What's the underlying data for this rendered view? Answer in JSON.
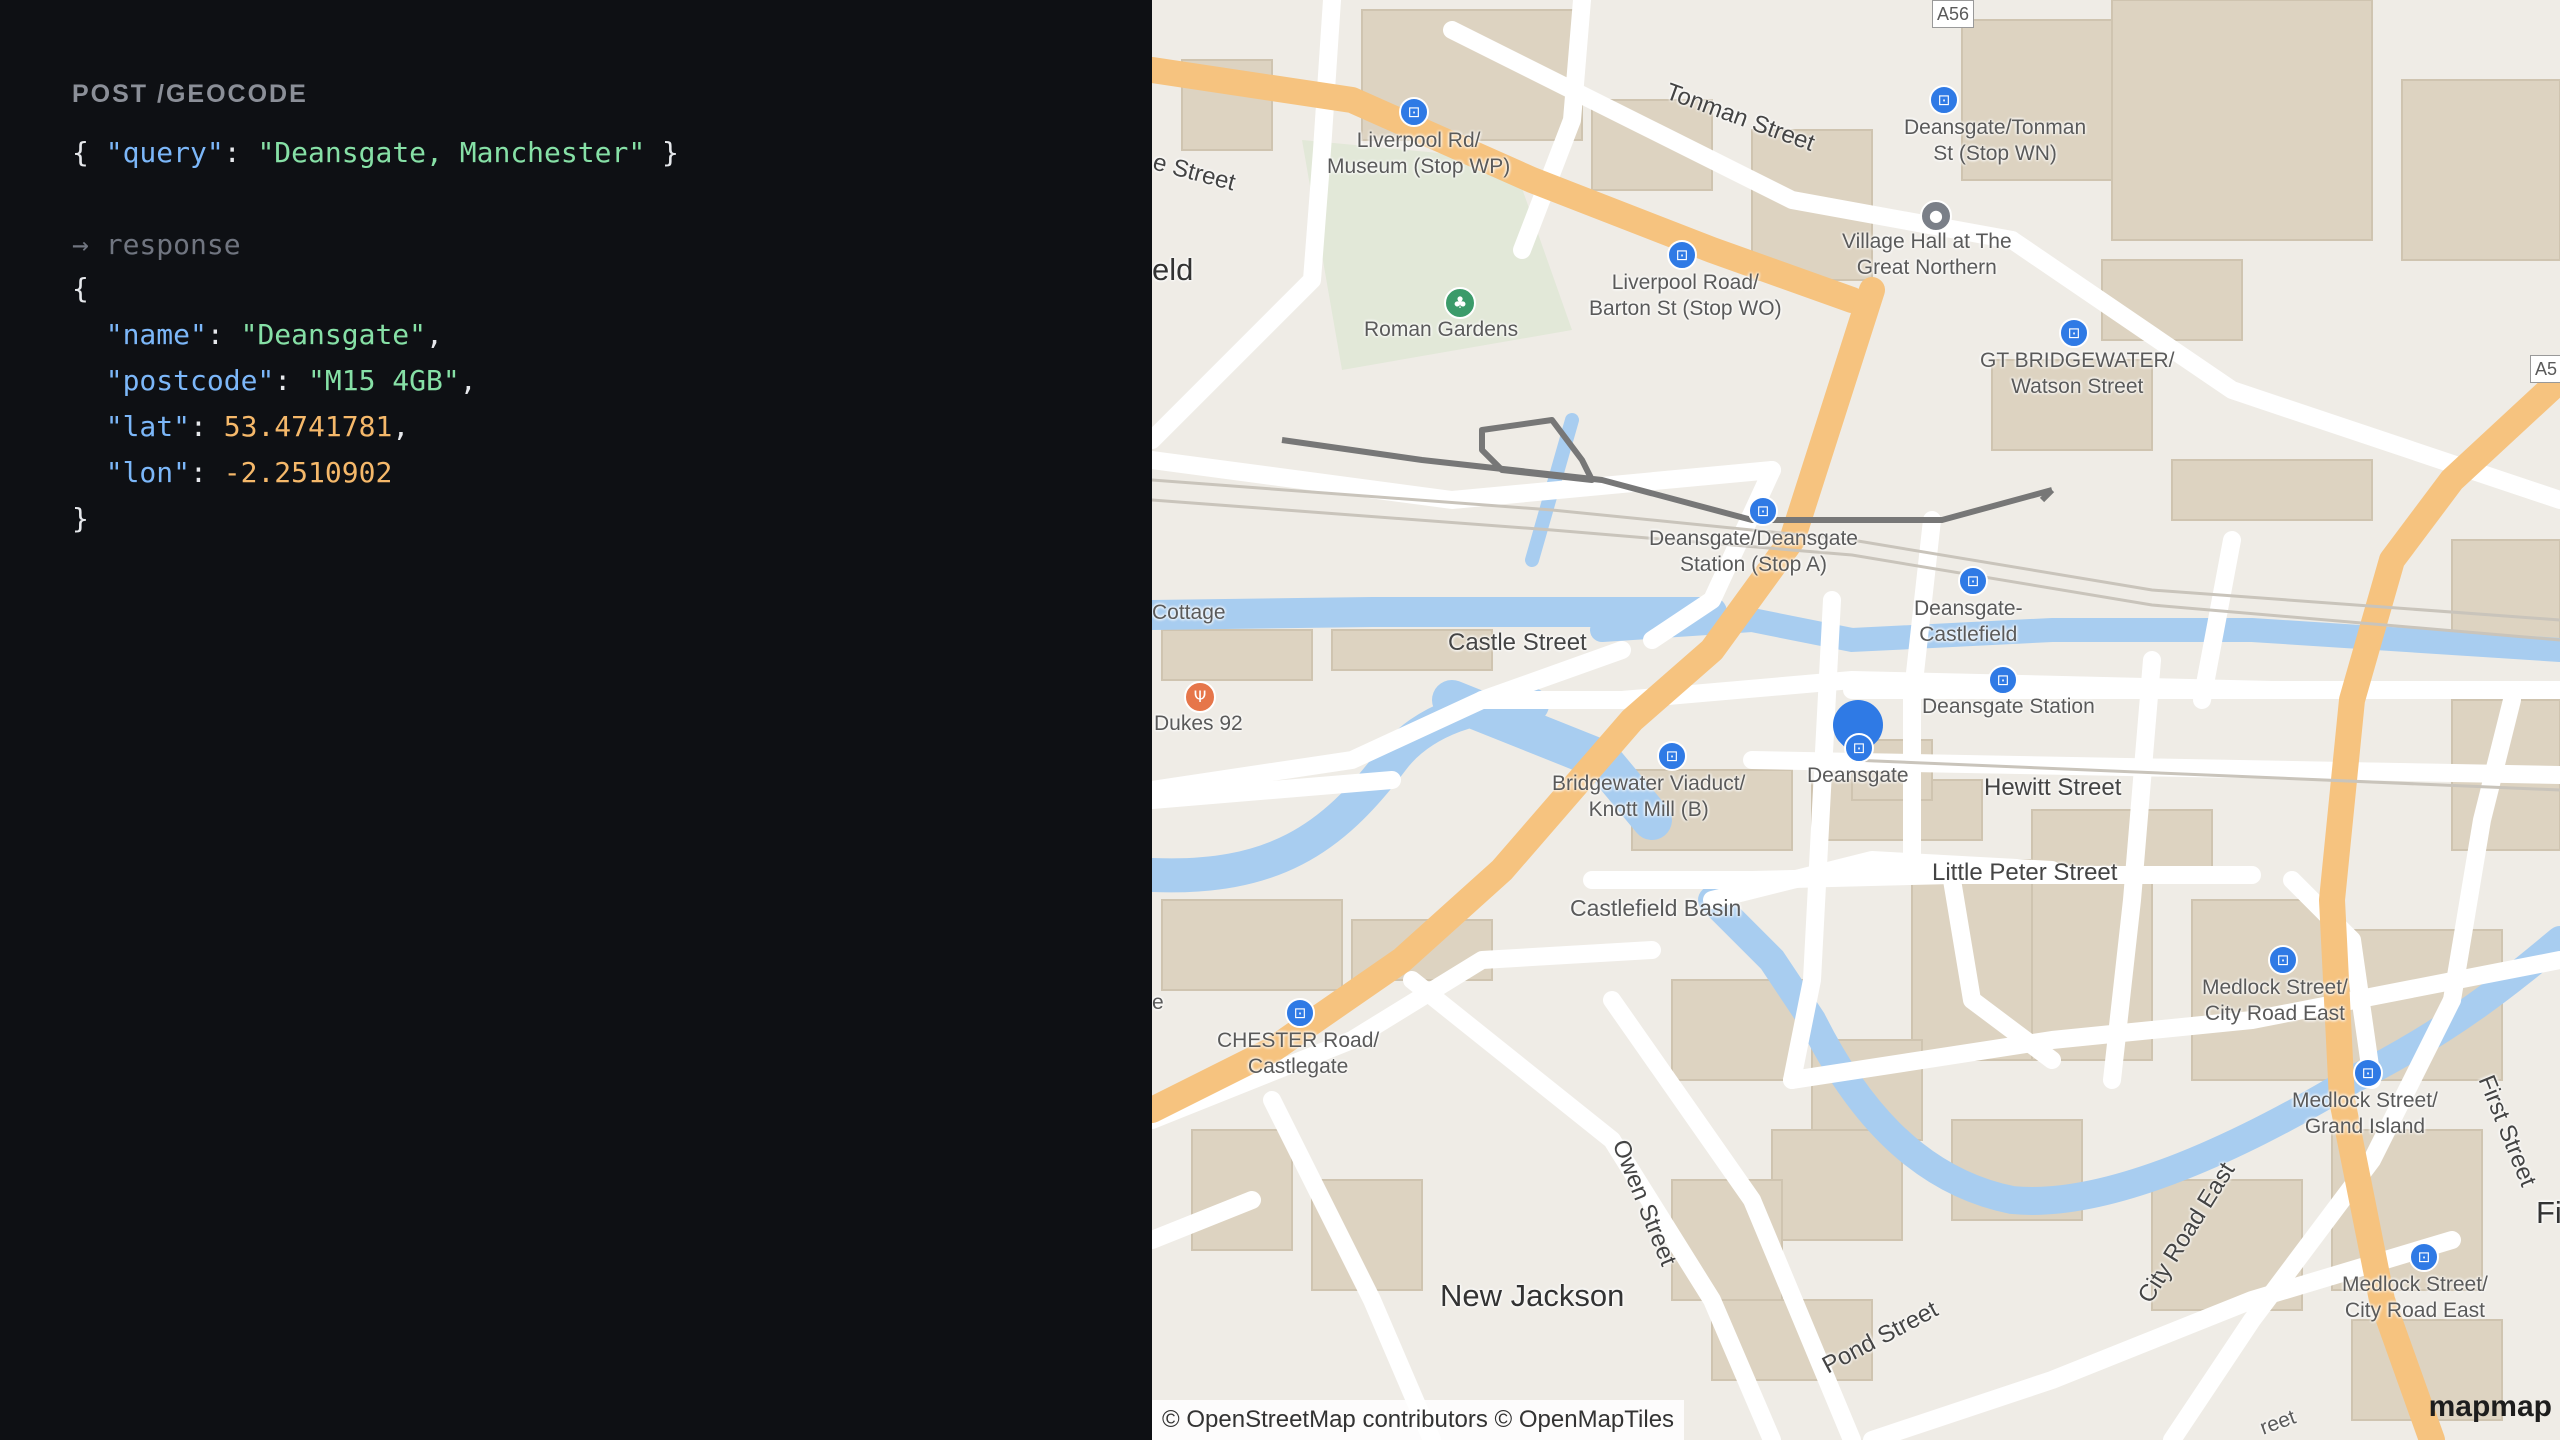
{
  "request": {
    "label": "POST /GEOCODE",
    "body_key": "\"query\"",
    "body_value": "\"Deansgate, Manchester\""
  },
  "response": {
    "label": "→ response",
    "fields": [
      {
        "key": "\"name\"",
        "value": "\"Deansgate\"",
        "type": "string"
      },
      {
        "key": "\"postcode\"",
        "value": "\"M15 4GB\"",
        "type": "string"
      },
      {
        "key": "\"lat\"",
        "value": "53.4741781",
        "type": "number"
      },
      {
        "key": "\"lon\"",
        "value": "-2.2510902",
        "type": "number"
      }
    ]
  },
  "map": {
    "attribution": "© OpenStreetMap contributors © OpenMapTiles",
    "logo": "mapmap",
    "marker_label": "Deansgate",
    "tram_stops": [
      {
        "name": "Liverpool Rd/\nMuseum (Stop WP)"
      },
      {
        "name": "Deansgate/Tonman\nSt (Stop WN)"
      },
      {
        "name": "Liverpool Road/\nBarton St (Stop WO)"
      },
      {
        "name": "GT BRIDGEWATER/\nWatson Street"
      },
      {
        "name": "Deansgate/Deansgate\nStation (Stop A)"
      },
      {
        "name": "Deansgate-\nCastlefield"
      },
      {
        "name": "Deansgate Station"
      },
      {
        "name": "Bridgewater Viaduct/\nKnott Mill (B)"
      },
      {
        "name": "CHESTER Road/\nCastlegate"
      },
      {
        "name": "Medlock Street/\nCity Road East"
      },
      {
        "name": "Medlock Street/\nGrand Island"
      },
      {
        "name": "Medlock Street/\nCity Road East"
      }
    ],
    "pois": [
      {
        "name": "Village Hall at The\nGreat Northern",
        "icon": "location-pin-icon",
        "color": "#7a7f88"
      },
      {
        "name": "Roman Gardens",
        "icon": "park-icon",
        "color": "#3b9b6a"
      },
      {
        "name": "Dukes 92",
        "icon": "restaurant-icon",
        "color": "#e6764a"
      }
    ],
    "streets": [
      "Tonman Street",
      "Castle Street",
      "Hewitt Street",
      "Little Peter Street",
      "Owen Street",
      "Pond Street",
      "City Road East",
      "First Street",
      "e Street"
    ],
    "places": [
      "Castlefield Basin",
      "New Jackson",
      "eld",
      "Cottage",
      "Fi",
      "A5",
      "A56",
      "e",
      "reet"
    ],
    "colors": {
      "road": "#ffffff",
      "major_road": "#f6c37f",
      "water": "#a8cdf0",
      "building": "#ddd3c1",
      "tram": "#2f7ae5",
      "marker": "#2f7ae5"
    }
  }
}
